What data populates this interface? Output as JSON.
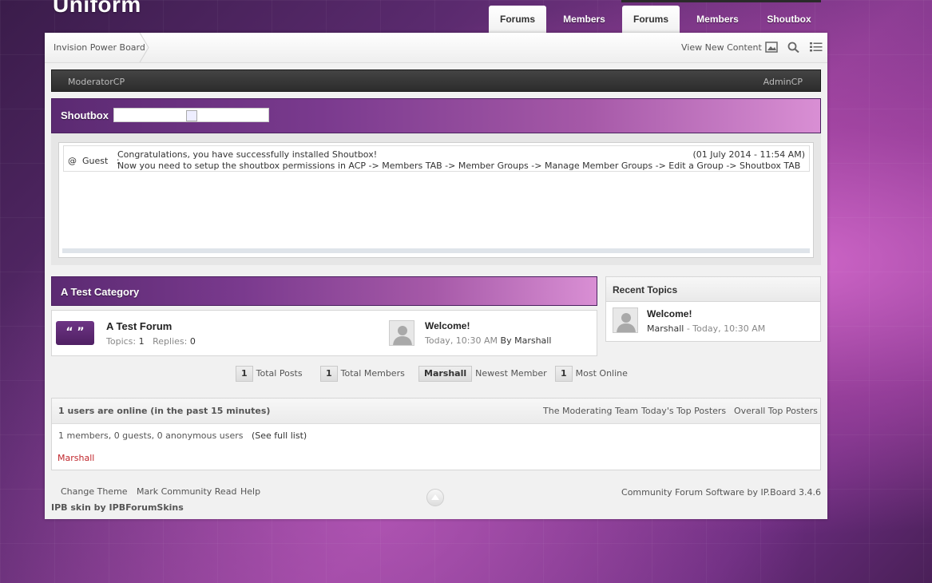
{
  "site": {
    "logo": "Uniform"
  },
  "nav_tabs": [
    {
      "label": "Forums",
      "active": true
    },
    {
      "label": "Members",
      "active": false
    },
    {
      "label": "Forums",
      "active": true
    },
    {
      "label": "Members",
      "active": false
    },
    {
      "label": "Shoutbox",
      "active": false
    }
  ],
  "breadcrumb": {
    "root": "Invision Power Board"
  },
  "header_links": {
    "view_new_content": "View New Content"
  },
  "icons": {
    "gallery": "image-icon",
    "search": "search-icon",
    "list": "list-icon"
  },
  "modbar": {
    "left": "ModeratorCP",
    "right": "AdminCP"
  },
  "shoutbox": {
    "title": "Shoutbox",
    "messages": [
      {
        "user_prefix": "@",
        "user": "Guest",
        "separator": ":",
        "line1": "Congratulations, you have successfully installed Shoutbox!",
        "line2": "Now you need to setup the shoutbox permissions in ACP -> Members TAB -> Member Groups -> Manage Member Groups -> Edit a Group -> Shoutbox TAB",
        "time": "(01 July 2014 - 11:54 AM)"
      }
    ]
  },
  "category": {
    "title": "A Test Category",
    "forum": {
      "icon_glyph": "“ ”",
      "name": "A Test Forum",
      "topics_label": "Topics:",
      "topics": "1",
      "replies_label": "Replies:",
      "replies": "0",
      "last_post": {
        "title": "Welcome!",
        "time": "Today, 10:30 AM",
        "by_label": "By",
        "author": "Marshall"
      }
    }
  },
  "recent_topics": {
    "title": "Recent Topics",
    "items": [
      {
        "title": "Welcome!",
        "author": "Marshall",
        "time": "- Today, 10:30 AM"
      }
    ]
  },
  "stats": [
    {
      "value": "1",
      "label": "Total Posts"
    },
    {
      "value": "1",
      "label": "Total Members"
    },
    {
      "value": "Marshall",
      "label": "Newest Member"
    },
    {
      "value": "1",
      "label": "Most Online"
    }
  ],
  "online": {
    "title": "1 users are online (in the past 15 minutes)",
    "links": [
      "The Moderating Team",
      "Today's Top Posters",
      "Overall Top Posters"
    ],
    "counts": "1 members, 0 guests, 0 anonymous users",
    "full_list": "(See full list)",
    "users": [
      "Marshall"
    ],
    "user_color": "#c0262c"
  },
  "footer": {
    "links": [
      "Change Theme",
      "Mark Community Read",
      "Help"
    ],
    "skin": "IPB skin by IPBForumSkins",
    "copyright": "Community Forum Software by IP.Board 3.4.6"
  },
  "colors": {
    "accent": "#6e3585",
    "bar_dark": "#2c2c2c"
  }
}
